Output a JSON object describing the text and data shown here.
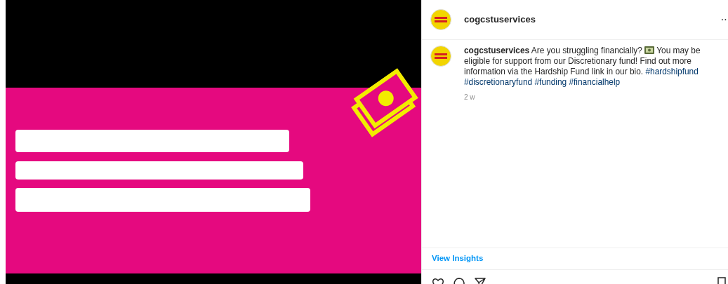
{
  "header": {
    "username": "cogcstuservices",
    "more": "··"
  },
  "caption": {
    "username": "cogcstuservices",
    "text_before_icon": "Are you struggling financially?",
    "text_after_icon": "You may be eligible for support from our Discretionary fund! Find out more information via the Hardship Fund link in our bio.",
    "hashtags": [
      "#hardshipfund",
      "#discretionaryfund",
      "#funding",
      "#financialhelp"
    ],
    "time": "2 w"
  },
  "insights_link": "View Insights"
}
